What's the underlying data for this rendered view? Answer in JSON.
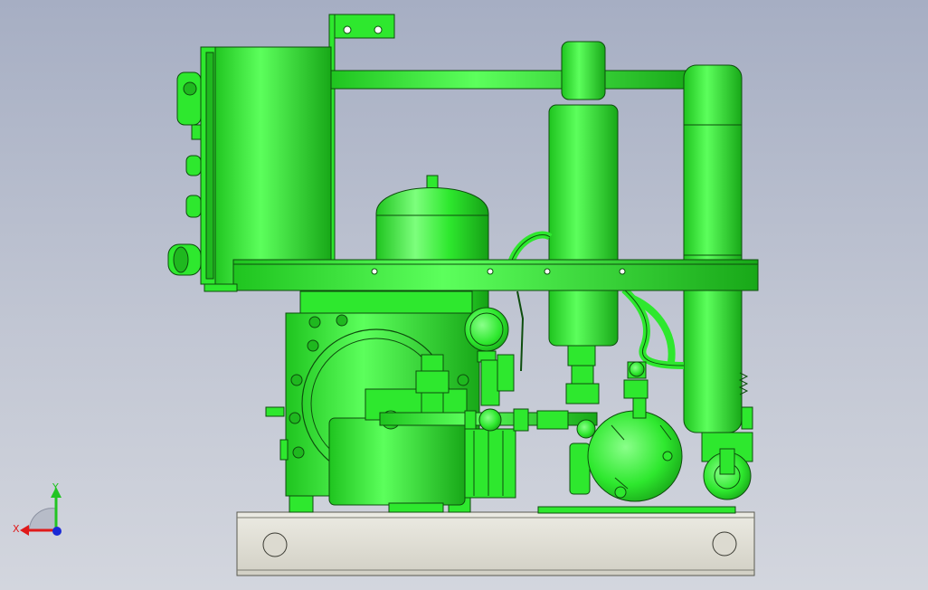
{
  "viewport": {
    "background_top": "#a6aec3",
    "background_bottom": "#d3d6de"
  },
  "model": {
    "part_color": "#2ee82e",
    "part_shade": "#1fb81f",
    "edge_color": "#0d4d0d",
    "base_color": "#e2e0d6"
  },
  "triad": {
    "x_label": "X",
    "y_label": "Y",
    "x_color": "#e01a1a",
    "y_color": "#22c422",
    "z_color": "#1a2ad6"
  }
}
